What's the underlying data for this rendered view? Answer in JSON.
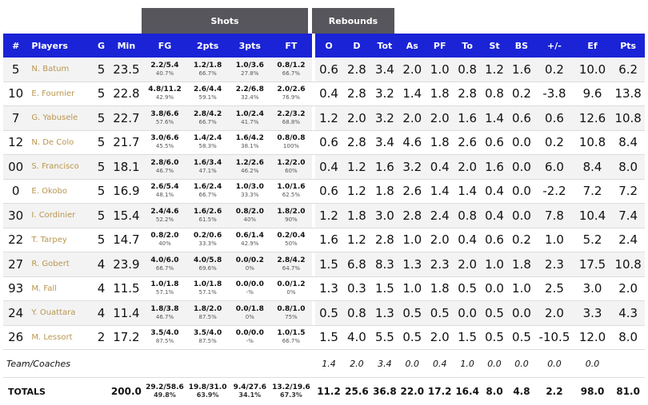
{
  "groups": {
    "shots": "Shots",
    "rebounds": "Rebounds"
  },
  "headers": {
    "num": "#",
    "players": "Players",
    "g": "G",
    "min": "Min",
    "fg": "FG",
    "two": "2pts",
    "three": "3pts",
    "ft": "FT",
    "o": "O",
    "d": "D",
    "tot": "Tot",
    "as": "As",
    "pf": "PF",
    "to": "To",
    "st": "St",
    "bs": "BS",
    "pm": "+/-",
    "ef": "Ef",
    "pts": "Pts"
  },
  "rows": [
    {
      "num": "5",
      "name": "N. Batum",
      "g": "5",
      "min": "23.5",
      "fg": "2.2/5.4",
      "fgp": "40.7%",
      "two": "1.2/1.8",
      "twop": "66.7%",
      "three": "1.0/3.6",
      "threep": "27.8%",
      "ft": "0.8/1.2",
      "ftp": "66.7%",
      "o": "0.6",
      "d": "2.8",
      "tot": "3.4",
      "as": "2.0",
      "pf": "1.0",
      "to": "0.8",
      "st": "1.2",
      "bs": "1.6",
      "pm": "0.2",
      "ef": "10.0",
      "pts": "6.2"
    },
    {
      "num": "10",
      "name": "E. Fournier",
      "g": "5",
      "min": "22.8",
      "fg": "4.8/11.2",
      "fgp": "42.9%",
      "two": "2.6/4.4",
      "twop": "59.1%",
      "three": "2.2/6.8",
      "threep": "32.4%",
      "ft": "2.0/2.6",
      "ftp": "76.9%",
      "o": "0.4",
      "d": "2.8",
      "tot": "3.2",
      "as": "1.4",
      "pf": "1.8",
      "to": "2.8",
      "st": "0.8",
      "bs": "0.2",
      "pm": "-3.8",
      "ef": "9.6",
      "pts": "13.8"
    },
    {
      "num": "7",
      "name": "G. Yabusele",
      "g": "5",
      "min": "22.7",
      "fg": "3.8/6.6",
      "fgp": "57.6%",
      "two": "2.8/4.2",
      "twop": "66.7%",
      "three": "1.0/2.4",
      "threep": "41.7%",
      "ft": "2.2/3.2",
      "ftp": "68.8%",
      "o": "1.2",
      "d": "2.0",
      "tot": "3.2",
      "as": "2.0",
      "pf": "2.0",
      "to": "1.6",
      "st": "1.4",
      "bs": "0.6",
      "pm": "0.6",
      "ef": "12.6",
      "pts": "10.8"
    },
    {
      "num": "12",
      "name": "N. De Colo",
      "g": "5",
      "min": "21.7",
      "fg": "3.0/6.6",
      "fgp": "45.5%",
      "two": "1.4/2.4",
      "twop": "58.3%",
      "three": "1.6/4.2",
      "threep": "38.1%",
      "ft": "0.8/0.8",
      "ftp": "100%",
      "o": "0.6",
      "d": "2.8",
      "tot": "3.4",
      "as": "4.6",
      "pf": "1.8",
      "to": "2.6",
      "st": "0.6",
      "bs": "0.0",
      "pm": "0.2",
      "ef": "10.8",
      "pts": "8.4"
    },
    {
      "num": "00",
      "name": "S. Francisco",
      "g": "5",
      "min": "18.1",
      "fg": "2.8/6.0",
      "fgp": "46.7%",
      "two": "1.6/3.4",
      "twop": "47.1%",
      "three": "1.2/2.6",
      "threep": "46.2%",
      "ft": "1.2/2.0",
      "ftp": "60%",
      "o": "0.4",
      "d": "1.2",
      "tot": "1.6",
      "as": "3.2",
      "pf": "0.4",
      "to": "2.0",
      "st": "1.6",
      "bs": "0.0",
      "pm": "6.0",
      "ef": "8.4",
      "pts": "8.0"
    },
    {
      "num": "0",
      "name": "E. Okobo",
      "g": "5",
      "min": "16.9",
      "fg": "2.6/5.4",
      "fgp": "48.1%",
      "two": "1.6/2.4",
      "twop": "66.7%",
      "three": "1.0/3.0",
      "threep": "33.3%",
      "ft": "1.0/1.6",
      "ftp": "62.5%",
      "o": "0.6",
      "d": "1.2",
      "tot": "1.8",
      "as": "2.6",
      "pf": "1.4",
      "to": "1.4",
      "st": "0.4",
      "bs": "0.0",
      "pm": "-2.2",
      "ef": "7.2",
      "pts": "7.2"
    },
    {
      "num": "30",
      "name": "I. Cordinier",
      "g": "5",
      "min": "15.4",
      "fg": "2.4/4.6",
      "fgp": "52.2%",
      "two": "1.6/2.6",
      "twop": "61.5%",
      "three": "0.8/2.0",
      "threep": "40%",
      "ft": "1.8/2.0",
      "ftp": "90%",
      "o": "1.2",
      "d": "1.8",
      "tot": "3.0",
      "as": "2.8",
      "pf": "2.4",
      "to": "0.8",
      "st": "0.4",
      "bs": "0.0",
      "pm": "7.8",
      "ef": "10.4",
      "pts": "7.4"
    },
    {
      "num": "22",
      "name": "T. Tarpey",
      "g": "5",
      "min": "14.7",
      "fg": "0.8/2.0",
      "fgp": "40%",
      "two": "0.2/0.6",
      "twop": "33.3%",
      "three": "0.6/1.4",
      "threep": "42.9%",
      "ft": "0.2/0.4",
      "ftp": "50%",
      "o": "1.6",
      "d": "1.2",
      "tot": "2.8",
      "as": "1.0",
      "pf": "2.0",
      "to": "0.4",
      "st": "0.6",
      "bs": "0.2",
      "pm": "1.0",
      "ef": "5.2",
      "pts": "2.4"
    },
    {
      "num": "27",
      "name": "R. Gobert",
      "g": "4",
      "min": "23.9",
      "fg": "4.0/6.0",
      "fgp": "66.7%",
      "two": "4.0/5.8",
      "twop": "69.6%",
      "three": "0.0/0.2",
      "threep": "0%",
      "ft": "2.8/4.2",
      "ftp": "64.7%",
      "o": "1.5",
      "d": "6.8",
      "tot": "8.3",
      "as": "1.3",
      "pf": "2.3",
      "to": "2.0",
      "st": "1.0",
      "bs": "1.8",
      "pm": "2.3",
      "ef": "17.5",
      "pts": "10.8"
    },
    {
      "num": "93",
      "name": "M. Fall",
      "g": "4",
      "min": "11.5",
      "fg": "1.0/1.8",
      "fgp": "57.1%",
      "two": "1.0/1.8",
      "twop": "57.1%",
      "three": "0.0/0.0",
      "threep": "-%",
      "ft": "0.0/1.2",
      "ftp": "0%",
      "o": "1.3",
      "d": "0.3",
      "tot": "1.5",
      "as": "1.0",
      "pf": "1.8",
      "to": "0.5",
      "st": "0.0",
      "bs": "1.0",
      "pm": "2.5",
      "ef": "3.0",
      "pts": "2.0"
    },
    {
      "num": "24",
      "name": "Y. Ouattara",
      "g": "4",
      "min": "11.4",
      "fg": "1.8/3.8",
      "fgp": "46.7%",
      "two": "1.8/2.0",
      "twop": "87.5%",
      "three": "0.0/1.8",
      "threep": "0%",
      "ft": "0.8/1.0",
      "ftp": "75%",
      "o": "0.5",
      "d": "0.8",
      "tot": "1.3",
      "as": "0.5",
      "pf": "0.5",
      "to": "0.0",
      "st": "0.5",
      "bs": "0.0",
      "pm": "2.0",
      "ef": "3.3",
      "pts": "4.3"
    },
    {
      "num": "26",
      "name": "M. Lessort",
      "g": "2",
      "min": "17.2",
      "fg": "3.5/4.0",
      "fgp": "87.5%",
      "two": "3.5/4.0",
      "twop": "87.5%",
      "three": "0.0/0.0",
      "threep": "-%",
      "ft": "1.0/1.5",
      "ftp": "66.7%",
      "o": "1.5",
      "d": "4.0",
      "tot": "5.5",
      "as": "0.5",
      "pf": "2.0",
      "to": "1.5",
      "st": "0.5",
      "bs": "0.5",
      "pm": "-10.5",
      "ef": "12.0",
      "pts": "8.0"
    }
  ],
  "coaches": {
    "label": "Team/Coaches",
    "o": "1.4",
    "d": "2.0",
    "tot": "3.4",
    "as": "0.0",
    "pf": "0.4",
    "to": "1.0",
    "st": "0.0",
    "bs": "0.0",
    "pm": "0.0",
    "ef": "0.0"
  },
  "totals": {
    "label": "TOTALS",
    "min": "200.0",
    "fg": "29.2/58.6",
    "fgp": "49.8%",
    "two": "19.8/31.0",
    "twop": "63.9%",
    "three": "9.4/27.6",
    "threep": "34.1%",
    "ft": "13.2/19.6",
    "ftp": "67.3%",
    "o": "11.2",
    "d": "25.6",
    "tot": "36.8",
    "as": "22.0",
    "pf": "17.2",
    "to": "16.4",
    "st": "8.0",
    "bs": "4.8",
    "pm": "2.2",
    "ef": "98.0",
    "pts": "81.0"
  }
}
